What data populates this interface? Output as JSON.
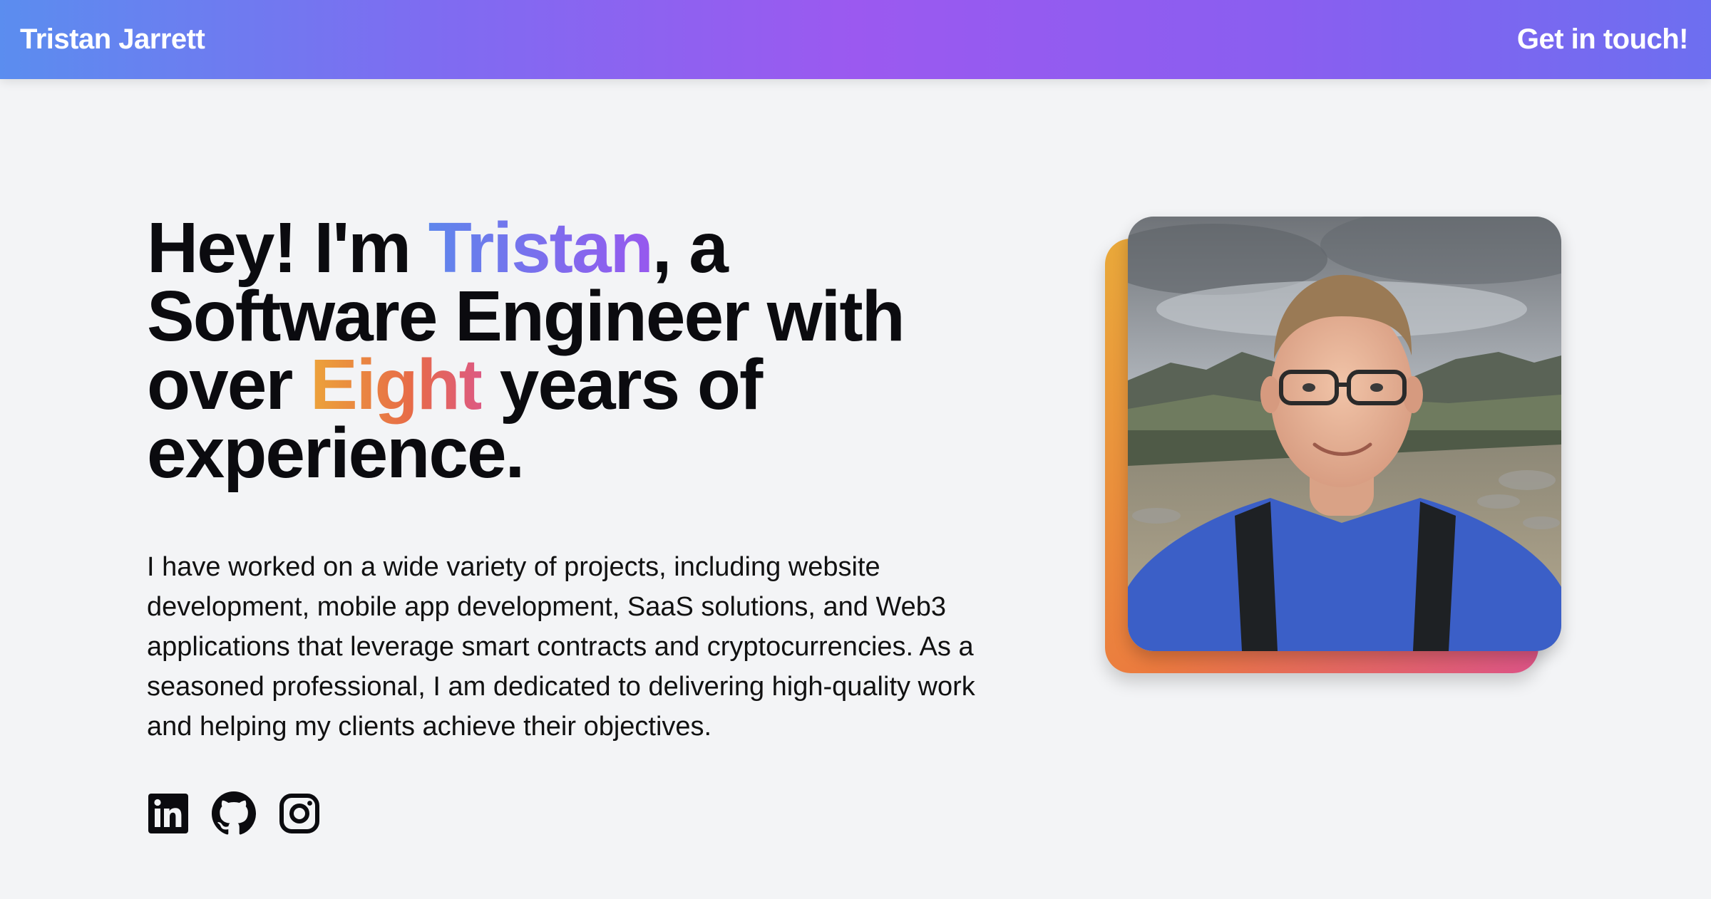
{
  "header": {
    "brand": "Tristan Jarrett",
    "cta_label": "Get in touch!"
  },
  "hero": {
    "line1_pre": "Hey! I'm ",
    "name_highlight": "Tristan",
    "line1_post": ", a",
    "line2": "Software Engineer with",
    "line3_pre": "over ",
    "years_highlight": "Eight",
    "line3_post": " years of",
    "line4": "experience."
  },
  "bio": {
    "text": "I have worked on a wide variety of projects, including website development, mobile app development, SaaS solutions, and Web3 applications that leverage smart contracts and cryptocurrencies. As a seasoned professional, I am dedicated to delivering high-quality work and helping my clients achieve their objectives."
  },
  "socials": [
    {
      "icon": "linkedin-icon"
    },
    {
      "icon": "github-icon"
    },
    {
      "icon": "instagram-icon"
    }
  ],
  "colors": {
    "header_gradient": [
      "#5b8def",
      "#9b59f0",
      "#6d6ff0"
    ],
    "name_gradient": [
      "#5e86ec",
      "#9758ee"
    ],
    "years_gradient": [
      "#eca33a",
      "#e76a48",
      "#dd5a82"
    ],
    "page_background": "#f3f4f6",
    "photo_backdrop": [
      "#e9a93a",
      "#eb7a3e",
      "#dd5488"
    ]
  }
}
